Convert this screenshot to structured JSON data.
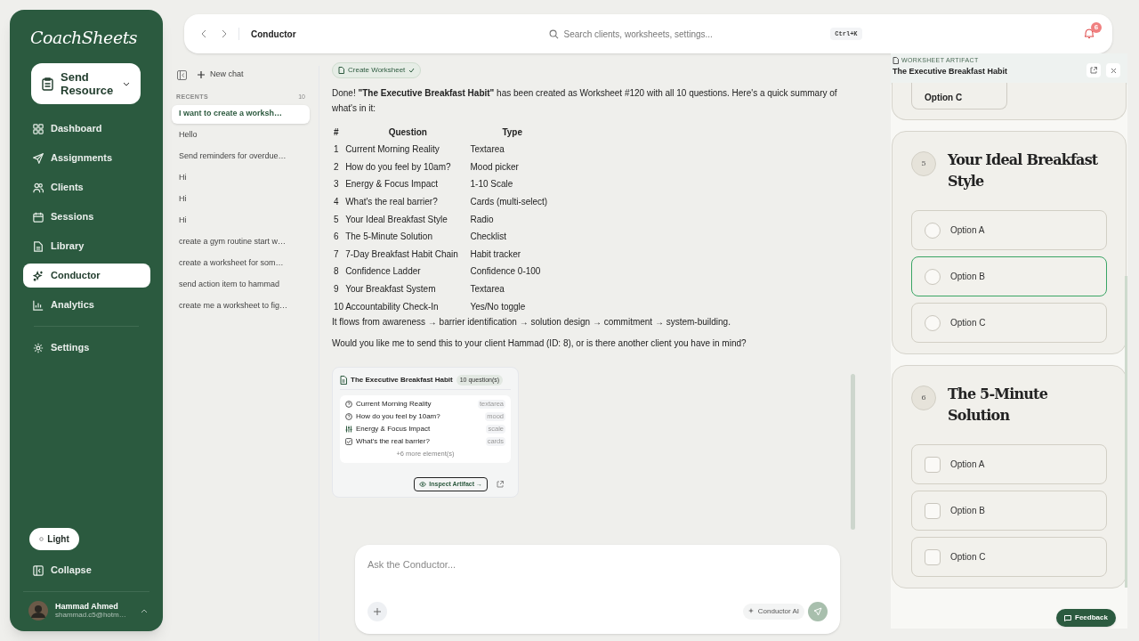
{
  "sidebar": {
    "logo": "CoachSheets",
    "send_resource": "Send Resource",
    "nav": [
      {
        "label": "Dashboard",
        "selected": false
      },
      {
        "label": "Assignments",
        "selected": false
      },
      {
        "label": "Clients",
        "selected": false
      },
      {
        "label": "Sessions",
        "selected": false
      },
      {
        "label": "Library",
        "selected": false
      },
      {
        "label": "Conductor",
        "selected": true
      },
      {
        "label": "Analytics",
        "selected": false
      }
    ],
    "settings": "Settings",
    "theme": "Light",
    "collapse": "Collapse",
    "user": {
      "name": "Hammad Ahmed",
      "email": "shammad.c5@hotm…"
    }
  },
  "topbar": {
    "title": "Conductor",
    "search_placeholder": "Search clients, worksheets, settings...",
    "shortcut": "Ctrl+K",
    "notifications": "6"
  },
  "chats": {
    "new_chat": "New chat",
    "recents_label": "RECENTS",
    "count": "10",
    "items": [
      {
        "label": "I want to create a worksh…",
        "selected": true
      },
      {
        "label": "Hello",
        "selected": false
      },
      {
        "label": "Send reminders for overdue…",
        "selected": false
      },
      {
        "label": "Hi",
        "selected": false
      },
      {
        "label": "Hi",
        "selected": false
      },
      {
        "label": "Hi",
        "selected": false
      },
      {
        "label": "create a gym routine start w…",
        "selected": false
      },
      {
        "label": "create a worksheet for som…",
        "selected": false
      },
      {
        "label": "send action item to hammad",
        "selected": false
      },
      {
        "label": "create me a worksheet to fig…",
        "selected": false
      }
    ]
  },
  "message": {
    "tool_chip": "Create Worksheet",
    "intro": "Done! **\"The Executive Breakfast Habit\"** has been created as Worksheet #120 with all 10 questions. Here's a quick summary of what's in it:",
    "table": {
      "columns": [
        "#",
        "Question",
        "Type"
      ],
      "rows": [
        [
          "1",
          "Current Morning Reality",
          "Textarea"
        ],
        [
          "2",
          "How do you feel by 10am?",
          "Mood picker"
        ],
        [
          "3",
          "Energy & Focus Impact",
          "1-10 Scale"
        ],
        [
          "4",
          "What's the real barrier?",
          "Cards (multi-select)"
        ],
        [
          "5",
          "Your Ideal Breakfast Style",
          "Radio"
        ],
        [
          "6",
          "The 5-Minute Solution",
          "Checklist"
        ],
        [
          "7",
          "7-Day Breakfast Habit Chain",
          "Habit tracker"
        ],
        [
          "8",
          "Confidence Ladder",
          "Confidence 0-100"
        ],
        [
          "9",
          "Your Breakfast System",
          "Textarea"
        ],
        [
          "10",
          "Accountability Check-In",
          "Yes/No toggle"
        ]
      ]
    },
    "flow": "It flows from awareness → barrier identification → solution design → commitment → system-building.",
    "question": "Would you like me to send this to your client Hammad (ID: 8), or is there another client you have in mind?",
    "artifact": {
      "title": "The Executive Breakfast Habit",
      "badge": "10 question(s)",
      "items": [
        {
          "label": "Current Morning Reality",
          "type": "textarea"
        },
        {
          "label": "How do you feel by 10am?",
          "type": "mood"
        },
        {
          "label": "Energy & Focus Impact",
          "type": "scale"
        },
        {
          "label": "What's the real barrier?",
          "type": "cards"
        }
      ],
      "more": "+6 more element(s)",
      "inspect": "Inspect Artifact →"
    }
  },
  "composer": {
    "placeholder": "Ask the Conductor...",
    "model": "Conductor AI"
  },
  "artifact_panel": {
    "label": "WORKSHEET ARTIFACT",
    "title": "The Executive Breakfast Habit",
    "partial_option": "Option C",
    "questions": [
      {
        "number": "5",
        "title": "Your Ideal Breakfast Style",
        "kind": "radio",
        "options": [
          {
            "label": "Option A",
            "focused": false
          },
          {
            "label": "Option B",
            "focused": true
          },
          {
            "label": "Option C",
            "focused": false
          }
        ]
      },
      {
        "number": "6",
        "title": "The 5-Minute Solution",
        "kind": "checkbox",
        "options": [
          {
            "label": "Option A",
            "focused": false
          },
          {
            "label": "Option B",
            "focused": false
          },
          {
            "label": "Option C",
            "focused": false
          }
        ]
      }
    ]
  },
  "feedback": "Feedback"
}
